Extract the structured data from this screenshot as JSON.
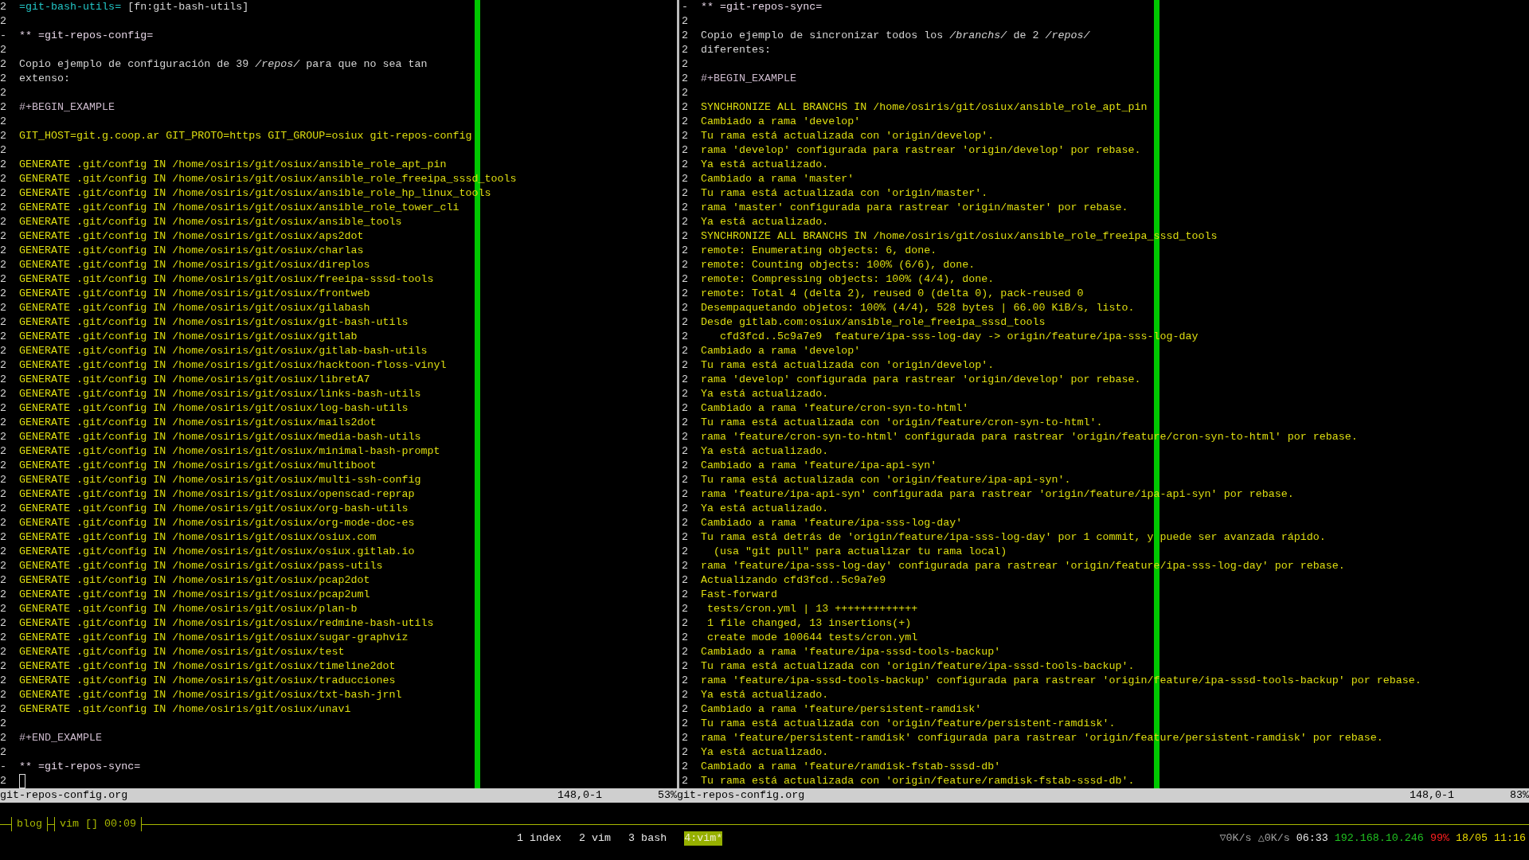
{
  "panes": [
    {
      "cursor_on_last_line": true,
      "lines": [
        {
          "fold": "2",
          "segments": [
            {
              "kind": "verbatim",
              "text": "=git-bash-utils="
            },
            {
              "kind": "plain",
              "text": " [fn:git-bash-utils]"
            }
          ]
        },
        {
          "fold": "2"
        },
        {
          "fold": "-",
          "kind": "heading",
          "text": "** =git-repos-config="
        },
        {
          "fold": "2"
        },
        {
          "fold": "2",
          "kind": "plain",
          "text": "Copio ejemplo de configuración de 39 */repos/* para que no sea tan"
        },
        {
          "fold": "2",
          "kind": "plain",
          "text": "extenso:"
        },
        {
          "fold": "2"
        },
        {
          "fold": "2",
          "kind": "keyword",
          "text": "#+BEGIN_EXAMPLE"
        },
        {
          "fold": "2"
        },
        {
          "fold": "2",
          "kind": "output",
          "text": "GIT_HOST=git.g.coop.ar GIT_PROTO=https GIT_GROUP=osiux git-repos-config"
        },
        {
          "fold": "2"
        },
        {
          "fold": "2",
          "kind": "output",
          "text": "GENERATE .git/config IN /home/osiris/git/osiux/ansible_role_apt_pin"
        },
        {
          "fold": "2",
          "kind": "output",
          "text": "GENERATE .git/config IN /home/osiris/git/osiux/ansible_role_freeipa_sssd_tools"
        },
        {
          "fold": "2",
          "kind": "output",
          "text": "GENERATE .git/config IN /home/osiris/git/osiux/ansible_role_hp_linux_tools"
        },
        {
          "fold": "2",
          "kind": "output",
          "text": "GENERATE .git/config IN /home/osiris/git/osiux/ansible_role_tower_cli"
        },
        {
          "fold": "2",
          "kind": "output",
          "text": "GENERATE .git/config IN /home/osiris/git/osiux/ansible_tools"
        },
        {
          "fold": "2",
          "kind": "output",
          "text": "GENERATE .git/config IN /home/osiris/git/osiux/aps2dot"
        },
        {
          "fold": "2",
          "kind": "output",
          "text": "GENERATE .git/config IN /home/osiris/git/osiux/charlas"
        },
        {
          "fold": "2",
          "kind": "output",
          "text": "GENERATE .git/config IN /home/osiris/git/osiux/direplos"
        },
        {
          "fold": "2",
          "kind": "output",
          "text": "GENERATE .git/config IN /home/osiris/git/osiux/freeipa-sssd-tools"
        },
        {
          "fold": "2",
          "kind": "output",
          "text": "GENERATE .git/config IN /home/osiris/git/osiux/frontweb"
        },
        {
          "fold": "2",
          "kind": "output",
          "text": "GENERATE .git/config IN /home/osiris/git/osiux/gilabash"
        },
        {
          "fold": "2",
          "kind": "output",
          "text": "GENERATE .git/config IN /home/osiris/git/osiux/git-bash-utils"
        },
        {
          "fold": "2",
          "kind": "output",
          "text": "GENERATE .git/config IN /home/osiris/git/osiux/gitlab"
        },
        {
          "fold": "2",
          "kind": "output",
          "text": "GENERATE .git/config IN /home/osiris/git/osiux/gitlab-bash-utils"
        },
        {
          "fold": "2",
          "kind": "output",
          "text": "GENERATE .git/config IN /home/osiris/git/osiux/hacktoon-floss-vinyl"
        },
        {
          "fold": "2",
          "kind": "output",
          "text": "GENERATE .git/config IN /home/osiris/git/osiux/libretA7"
        },
        {
          "fold": "2",
          "kind": "output",
          "text": "GENERATE .git/config IN /home/osiris/git/osiux/links-bash-utils"
        },
        {
          "fold": "2",
          "kind": "output",
          "text": "GENERATE .git/config IN /home/osiris/git/osiux/log-bash-utils"
        },
        {
          "fold": "2",
          "kind": "output",
          "text": "GENERATE .git/config IN /home/osiris/git/osiux/mails2dot"
        },
        {
          "fold": "2",
          "kind": "output",
          "text": "GENERATE .git/config IN /home/osiris/git/osiux/media-bash-utils"
        },
        {
          "fold": "2",
          "kind": "output",
          "text": "GENERATE .git/config IN /home/osiris/git/osiux/minimal-bash-prompt"
        },
        {
          "fold": "2",
          "kind": "output",
          "text": "GENERATE .git/config IN /home/osiris/git/osiux/multiboot"
        },
        {
          "fold": "2",
          "kind": "output",
          "text": "GENERATE .git/config IN /home/osiris/git/osiux/multi-ssh-config"
        },
        {
          "fold": "2",
          "kind": "output",
          "text": "GENERATE .git/config IN /home/osiris/git/osiux/openscad-reprap"
        },
        {
          "fold": "2",
          "kind": "output",
          "text": "GENERATE .git/config IN /home/osiris/git/osiux/org-bash-utils"
        },
        {
          "fold": "2",
          "kind": "output",
          "text": "GENERATE .git/config IN /home/osiris/git/osiux/org-mode-doc-es"
        },
        {
          "fold": "2",
          "kind": "output",
          "text": "GENERATE .git/config IN /home/osiris/git/osiux/osiux.com"
        },
        {
          "fold": "2",
          "kind": "output",
          "text": "GENERATE .git/config IN /home/osiris/git/osiux/osiux.gitlab.io"
        },
        {
          "fold": "2",
          "kind": "output",
          "text": "GENERATE .git/config IN /home/osiris/git/osiux/pass-utils"
        },
        {
          "fold": "2",
          "kind": "output",
          "text": "GENERATE .git/config IN /home/osiris/git/osiux/pcap2dot"
        },
        {
          "fold": "2",
          "kind": "output",
          "text": "GENERATE .git/config IN /home/osiris/git/osiux/pcap2uml"
        },
        {
          "fold": "2",
          "kind": "output",
          "text": "GENERATE .git/config IN /home/osiris/git/osiux/plan-b"
        },
        {
          "fold": "2",
          "kind": "output",
          "text": "GENERATE .git/config IN /home/osiris/git/osiux/redmine-bash-utils"
        },
        {
          "fold": "2",
          "kind": "output",
          "text": "GENERATE .git/config IN /home/osiris/git/osiux/sugar-graphviz"
        },
        {
          "fold": "2",
          "kind": "output",
          "text": "GENERATE .git/config IN /home/osiris/git/osiux/test"
        },
        {
          "fold": "2",
          "kind": "output",
          "text": "GENERATE .git/config IN /home/osiris/git/osiux/timeline2dot"
        },
        {
          "fold": "2",
          "kind": "output",
          "text": "GENERATE .git/config IN /home/osiris/git/osiux/traducciones"
        },
        {
          "fold": "2",
          "kind": "output",
          "text": "GENERATE .git/config IN /home/osiris/git/osiux/txt-bash-jrnl"
        },
        {
          "fold": "2",
          "kind": "output",
          "text": "GENERATE .git/config IN /home/osiris/git/osiux/unavi"
        },
        {
          "fold": "2"
        },
        {
          "fold": "2",
          "kind": "keyword",
          "text": "#+END_EXAMPLE"
        },
        {
          "fold": "2"
        },
        {
          "fold": "-",
          "kind": "heading",
          "text": "** =git-repos-sync="
        },
        {
          "fold": "2"
        }
      ],
      "status": {
        "file": "git-repos-config.org",
        "position": "148,0-1",
        "percent": "53%"
      }
    },
    {
      "cursor_on_last_line": false,
      "lines": [
        {
          "fold": "-",
          "kind": "heading",
          "text": "** =git-repos-sync="
        },
        {
          "fold": "2"
        },
        {
          "fold": "2",
          "kind": "plain",
          "text": "Copio ejemplo de sincronizar todos los */branchs/* de 2 */repos/*"
        },
        {
          "fold": "2",
          "kind": "plain",
          "text": "diferentes:"
        },
        {
          "fold": "2"
        },
        {
          "fold": "2",
          "kind": "keyword",
          "text": "#+BEGIN_EXAMPLE"
        },
        {
          "fold": "2"
        },
        {
          "fold": "2",
          "kind": "output",
          "text": "SYNCHRONIZE ALL BRANCHS IN /home/osiris/git/osiux/ansible_role_apt_pin"
        },
        {
          "fold": "2",
          "kind": "output",
          "text": "Cambiado a rama 'develop'"
        },
        {
          "fold": "2",
          "kind": "output",
          "text": "Tu rama está actualizada con 'origin/develop'."
        },
        {
          "fold": "2",
          "kind": "output",
          "text": "rama 'develop' configurada para rastrear 'origin/develop' por rebase."
        },
        {
          "fold": "2",
          "kind": "output",
          "text": "Ya está actualizado."
        },
        {
          "fold": "2",
          "kind": "output",
          "text": "Cambiado a rama 'master'"
        },
        {
          "fold": "2",
          "kind": "output",
          "text": "Tu rama está actualizada con 'origin/master'."
        },
        {
          "fold": "2",
          "kind": "output",
          "text": "rama 'master' configurada para rastrear 'origin/master' por rebase."
        },
        {
          "fold": "2",
          "kind": "output",
          "text": "Ya está actualizado."
        },
        {
          "fold": "2",
          "kind": "output",
          "text": "SYNCHRONIZE ALL BRANCHS IN /home/osiris/git/osiux/ansible_role_freeipa_sssd_tools"
        },
        {
          "fold": "2",
          "kind": "output",
          "text": "remote: Enumerating objects: 6, done."
        },
        {
          "fold": "2",
          "kind": "output",
          "text": "remote: Counting objects: 100% (6/6), done."
        },
        {
          "fold": "2",
          "kind": "output",
          "text": "remote: Compressing objects: 100% (4/4), done."
        },
        {
          "fold": "2",
          "kind": "output",
          "text": "remote: Total 4 (delta 2), reused 0 (delta 0), pack-reused 0"
        },
        {
          "fold": "2",
          "kind": "output",
          "text": "Desempaquetando objetos: 100% (4/4), 528 bytes | 66.00 KiB/s, listo."
        },
        {
          "fold": "2",
          "kind": "output",
          "text": "Desde gitlab.com:osiux/ansible_role_freeipa_sssd_tools"
        },
        {
          "fold": "2",
          "kind": "output",
          "text": "   cfd3fcd..5c9a7e9  feature/ipa-sss-log-day -> origin/feature/ipa-sss-log-day"
        },
        {
          "fold": "2",
          "kind": "output",
          "text": "Cambiado a rama 'develop'"
        },
        {
          "fold": "2",
          "kind": "output",
          "text": "Tu rama está actualizada con 'origin/develop'."
        },
        {
          "fold": "2",
          "kind": "output",
          "text": "rama 'develop' configurada para rastrear 'origin/develop' por rebase."
        },
        {
          "fold": "2",
          "kind": "output",
          "text": "Ya está actualizado."
        },
        {
          "fold": "2",
          "kind": "output",
          "text": "Cambiado a rama 'feature/cron-syn-to-html'"
        },
        {
          "fold": "2",
          "kind": "output",
          "text": "Tu rama está actualizada con 'origin/feature/cron-syn-to-html'."
        },
        {
          "fold": "2",
          "kind": "output",
          "text": "rama 'feature/cron-syn-to-html' configurada para rastrear 'origin/feature/cron-syn-to-html' por rebase."
        },
        {
          "fold": "2",
          "kind": "output",
          "text": "Ya está actualizado."
        },
        {
          "fold": "2",
          "kind": "output",
          "text": "Cambiado a rama 'feature/ipa-api-syn'"
        },
        {
          "fold": "2",
          "kind": "output",
          "text": "Tu rama está actualizada con 'origin/feature/ipa-api-syn'."
        },
        {
          "fold": "2",
          "kind": "output",
          "text": "rama 'feature/ipa-api-syn' configurada para rastrear 'origin/feature/ipa-api-syn' por rebase."
        },
        {
          "fold": "2",
          "kind": "output",
          "text": "Ya está actualizado."
        },
        {
          "fold": "2",
          "kind": "output",
          "text": "Cambiado a rama 'feature/ipa-sss-log-day'"
        },
        {
          "fold": "2",
          "kind": "output",
          "text": "Tu rama está detrás de 'origin/feature/ipa-sss-log-day' por 1 commit, y puede ser avanzada rápido."
        },
        {
          "fold": "2",
          "kind": "output",
          "text": "  (usa \"git pull\" para actualizar tu rama local)"
        },
        {
          "fold": "2",
          "kind": "output",
          "text": "rama 'feature/ipa-sss-log-day' configurada para rastrear 'origin/feature/ipa-sss-log-day' por rebase."
        },
        {
          "fold": "2",
          "kind": "output",
          "text": "Actualizando cfd3fcd..5c9a7e9"
        },
        {
          "fold": "2",
          "kind": "output",
          "text": "Fast-forward"
        },
        {
          "fold": "2",
          "kind": "output",
          "text": " tests/cron.yml | 13 +++++++++++++"
        },
        {
          "fold": "2",
          "kind": "output",
          "text": " 1 file changed, 13 insertions(+)"
        },
        {
          "fold": "2",
          "kind": "output",
          "text": " create mode 100644 tests/cron.yml"
        },
        {
          "fold": "2",
          "kind": "output",
          "text": "Cambiado a rama 'feature/ipa-sssd-tools-backup'"
        },
        {
          "fold": "2",
          "kind": "output",
          "text": "Tu rama está actualizada con 'origin/feature/ipa-sssd-tools-backup'."
        },
        {
          "fold": "2",
          "kind": "output",
          "text": "rama 'feature/ipa-sssd-tools-backup' configurada para rastrear 'origin/feature/ipa-sssd-tools-backup' por rebase."
        },
        {
          "fold": "2",
          "kind": "output",
          "text": "Ya está actualizado."
        },
        {
          "fold": "2",
          "kind": "output",
          "text": "Cambiado a rama 'feature/persistent-ramdisk'"
        },
        {
          "fold": "2",
          "kind": "output",
          "text": "Tu rama está actualizada con 'origin/feature/persistent-ramdisk'."
        },
        {
          "fold": "2",
          "kind": "output",
          "text": "rama 'feature/persistent-ramdisk' configurada para rastrear 'origin/feature/persistent-ramdisk' por rebase."
        },
        {
          "fold": "2",
          "kind": "output",
          "text": "Ya está actualizado."
        },
        {
          "fold": "2",
          "kind": "output",
          "text": "Cambiado a rama 'feature/ramdisk-fstab-sssd-db'"
        },
        {
          "fold": "2",
          "kind": "output",
          "text": "Tu rama está actualizada con 'origin/feature/ramdisk-fstab-sssd-db'."
        }
      ],
      "status": {
        "file": "git-repos-config.org",
        "position": "148,0-1",
        "percent": "83%"
      }
    }
  ],
  "session_bar": {
    "items": [
      {
        "label": "blog"
      },
      {
        "label": "vim [] 00:09"
      }
    ]
  },
  "window_list": [
    {
      "label": "1 index",
      "selected": false
    },
    {
      "label": "2 vim",
      "selected": false
    },
    {
      "label": "3 bash",
      "selected": false
    },
    {
      "label": "4:vim*",
      "selected": true
    }
  ],
  "system_status": [
    {
      "kind": "net",
      "text": "▽0K/s"
    },
    {
      "kind": "net",
      "text": "△0K/s"
    },
    {
      "kind": "uptime",
      "text": "06:33"
    },
    {
      "kind": "ip",
      "text": "192.168.10.246"
    },
    {
      "kind": "battery",
      "text": "99%"
    },
    {
      "kind": "clock",
      "text": "18/05 11:16"
    }
  ]
}
